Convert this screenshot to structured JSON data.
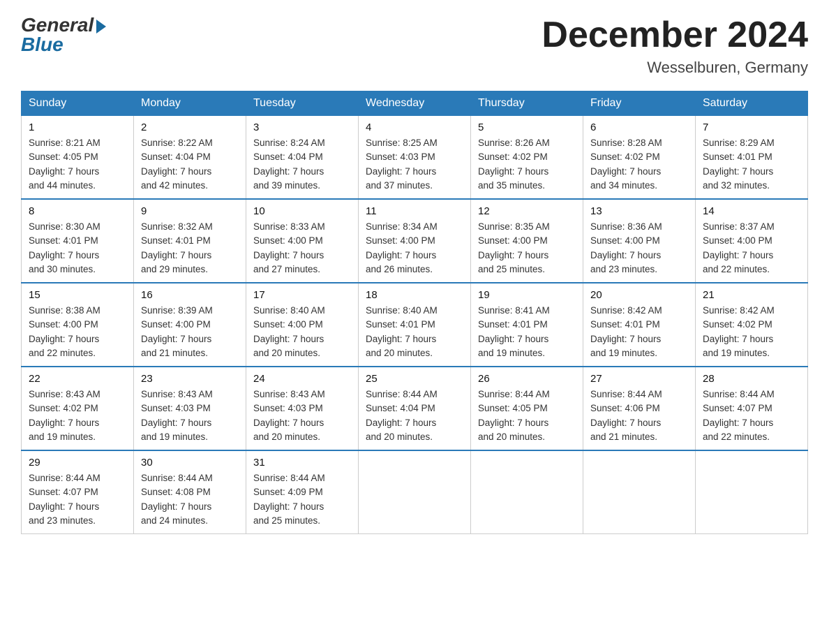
{
  "logo": {
    "general": "General",
    "blue": "Blue"
  },
  "title": "December 2024",
  "location": "Wesselburen, Germany",
  "headers": [
    "Sunday",
    "Monday",
    "Tuesday",
    "Wednesday",
    "Thursday",
    "Friday",
    "Saturday"
  ],
  "weeks": [
    [
      {
        "day": "1",
        "sunrise": "8:21 AM",
        "sunset": "4:05 PM",
        "daylight": "7 hours and 44 minutes."
      },
      {
        "day": "2",
        "sunrise": "8:22 AM",
        "sunset": "4:04 PM",
        "daylight": "7 hours and 42 minutes."
      },
      {
        "day": "3",
        "sunrise": "8:24 AM",
        "sunset": "4:04 PM",
        "daylight": "7 hours and 39 minutes."
      },
      {
        "day": "4",
        "sunrise": "8:25 AM",
        "sunset": "4:03 PM",
        "daylight": "7 hours and 37 minutes."
      },
      {
        "day": "5",
        "sunrise": "8:26 AM",
        "sunset": "4:02 PM",
        "daylight": "7 hours and 35 minutes."
      },
      {
        "day": "6",
        "sunrise": "8:28 AM",
        "sunset": "4:02 PM",
        "daylight": "7 hours and 34 minutes."
      },
      {
        "day": "7",
        "sunrise": "8:29 AM",
        "sunset": "4:01 PM",
        "daylight": "7 hours and 32 minutes."
      }
    ],
    [
      {
        "day": "8",
        "sunrise": "8:30 AM",
        "sunset": "4:01 PM",
        "daylight": "7 hours and 30 minutes."
      },
      {
        "day": "9",
        "sunrise": "8:32 AM",
        "sunset": "4:01 PM",
        "daylight": "7 hours and 29 minutes."
      },
      {
        "day": "10",
        "sunrise": "8:33 AM",
        "sunset": "4:00 PM",
        "daylight": "7 hours and 27 minutes."
      },
      {
        "day": "11",
        "sunrise": "8:34 AM",
        "sunset": "4:00 PM",
        "daylight": "7 hours and 26 minutes."
      },
      {
        "day": "12",
        "sunrise": "8:35 AM",
        "sunset": "4:00 PM",
        "daylight": "7 hours and 25 minutes."
      },
      {
        "day": "13",
        "sunrise": "8:36 AM",
        "sunset": "4:00 PM",
        "daylight": "7 hours and 23 minutes."
      },
      {
        "day": "14",
        "sunrise": "8:37 AM",
        "sunset": "4:00 PM",
        "daylight": "7 hours and 22 minutes."
      }
    ],
    [
      {
        "day": "15",
        "sunrise": "8:38 AM",
        "sunset": "4:00 PM",
        "daylight": "7 hours and 22 minutes."
      },
      {
        "day": "16",
        "sunrise": "8:39 AM",
        "sunset": "4:00 PM",
        "daylight": "7 hours and 21 minutes."
      },
      {
        "day": "17",
        "sunrise": "8:40 AM",
        "sunset": "4:00 PM",
        "daylight": "7 hours and 20 minutes."
      },
      {
        "day": "18",
        "sunrise": "8:40 AM",
        "sunset": "4:01 PM",
        "daylight": "7 hours and 20 minutes."
      },
      {
        "day": "19",
        "sunrise": "8:41 AM",
        "sunset": "4:01 PM",
        "daylight": "7 hours and 19 minutes."
      },
      {
        "day": "20",
        "sunrise": "8:42 AM",
        "sunset": "4:01 PM",
        "daylight": "7 hours and 19 minutes."
      },
      {
        "day": "21",
        "sunrise": "8:42 AM",
        "sunset": "4:02 PM",
        "daylight": "7 hours and 19 minutes."
      }
    ],
    [
      {
        "day": "22",
        "sunrise": "8:43 AM",
        "sunset": "4:02 PM",
        "daylight": "7 hours and 19 minutes."
      },
      {
        "day": "23",
        "sunrise": "8:43 AM",
        "sunset": "4:03 PM",
        "daylight": "7 hours and 19 minutes."
      },
      {
        "day": "24",
        "sunrise": "8:43 AM",
        "sunset": "4:03 PM",
        "daylight": "7 hours and 20 minutes."
      },
      {
        "day": "25",
        "sunrise": "8:44 AM",
        "sunset": "4:04 PM",
        "daylight": "7 hours and 20 minutes."
      },
      {
        "day": "26",
        "sunrise": "8:44 AM",
        "sunset": "4:05 PM",
        "daylight": "7 hours and 20 minutes."
      },
      {
        "day": "27",
        "sunrise": "8:44 AM",
        "sunset": "4:06 PM",
        "daylight": "7 hours and 21 minutes."
      },
      {
        "day": "28",
        "sunrise": "8:44 AM",
        "sunset": "4:07 PM",
        "daylight": "7 hours and 22 minutes."
      }
    ],
    [
      {
        "day": "29",
        "sunrise": "8:44 AM",
        "sunset": "4:07 PM",
        "daylight": "7 hours and 23 minutes."
      },
      {
        "day": "30",
        "sunrise": "8:44 AM",
        "sunset": "4:08 PM",
        "daylight": "7 hours and 24 minutes."
      },
      {
        "day": "31",
        "sunrise": "8:44 AM",
        "sunset": "4:09 PM",
        "daylight": "7 hours and 25 minutes."
      },
      null,
      null,
      null,
      null
    ]
  ],
  "labels": {
    "sunrise": "Sunrise:",
    "sunset": "Sunset:",
    "daylight": "Daylight:"
  }
}
